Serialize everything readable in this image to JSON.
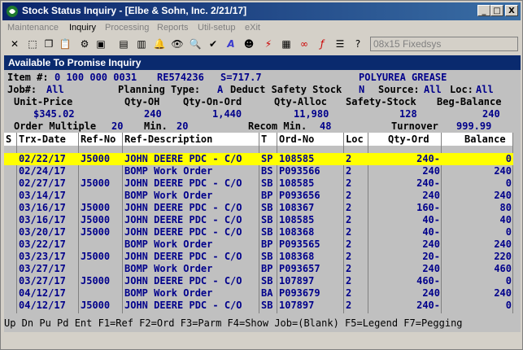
{
  "window": {
    "title": "Stock Status Inquiry - [Elbe & Sohn, Inc. 2/21/17]",
    "buttons": {
      "minimize": "_",
      "maximize": "□",
      "close": "X"
    }
  },
  "menu": {
    "items": [
      {
        "label": "Maintenance",
        "enabled": false
      },
      {
        "label": "Inquiry",
        "enabled": true
      },
      {
        "label": "Processing",
        "enabled": false
      },
      {
        "label": "Reports",
        "enabled": false
      },
      {
        "label": "Util-setup",
        "enabled": false
      },
      {
        "label": "eXit",
        "enabled": false
      }
    ]
  },
  "toolbar": {
    "font_select": "08x15 Fixedsys"
  },
  "screen": {
    "header": "Available To Promise Inquiry",
    "item_line": {
      "item_label": "Item #:",
      "item_number": "0 100 000 0031",
      "ref_no": "RE574236",
      "s_value": "S=717.7",
      "description": "POLYUREA GREASE"
    },
    "job_line": {
      "job_label": "Job#:",
      "job_value": "All",
      "planning_label": "Planning Type:",
      "planning_value": "A",
      "deduct_label": "Deduct Safety Stock",
      "deduct_value": "N",
      "source_label": "Source:",
      "source_value": "All",
      "loc_label": "Loc:",
      "loc_value": "All"
    },
    "stats_headers": {
      "unit_price": "Unit-Price",
      "qty_oh": "Qty-OH",
      "qty_on_ord": "Qty-On-Ord",
      "qty_alloc": "Qty-Alloc",
      "safety_stock": "Safety-Stock",
      "beg_balance": "Beg-Balance"
    },
    "stats_values": {
      "unit_price": "$345.02",
      "qty_oh": "240",
      "qty_on_ord": "1,440",
      "qty_alloc": "11,980",
      "safety_stock": "128",
      "beg_balance": "240"
    },
    "order_line": {
      "order_multiple_label": "Order Multiple",
      "order_multiple_value": "20",
      "min_label": "Min.",
      "min_value": "20",
      "recom_min_label": "Recom Min.",
      "recom_min_value": "48",
      "turnover_label": "Turnover",
      "turnover_value": "999.99"
    }
  },
  "table": {
    "columns": [
      "S",
      "Trx-Date",
      "Ref-No",
      "Ref-Description",
      "T",
      "Ord-No",
      "Loc",
      "Qty-Ord",
      "Balance"
    ],
    "rows": [
      {
        "s": "",
        "date": "02/22/17",
        "ref_no": "J5000",
        "desc": "JOHN DEERE PDC - C/O",
        "t": "SP",
        "ord_no": "108585",
        "loc": "2",
        "qty": "240-",
        "bal": "0",
        "selected": true
      },
      {
        "s": "",
        "date": "02/24/17",
        "ref_no": "",
        "desc": "BOMP Work Order",
        "t": "BS",
        "ord_no": "P093566",
        "loc": "2",
        "qty": "240",
        "bal": "240"
      },
      {
        "s": "",
        "date": "02/27/17",
        "ref_no": "J5000",
        "desc": "JOHN DEERE PDC - C/O",
        "t": "SB",
        "ord_no": "108585",
        "loc": "2",
        "qty": "240-",
        "bal": "0"
      },
      {
        "s": "",
        "date": "03/14/17",
        "ref_no": "",
        "desc": "BOMP Work Order",
        "t": "BP",
        "ord_no": "P093656",
        "loc": "2",
        "qty": "240",
        "bal": "240"
      },
      {
        "s": "",
        "date": "03/16/17",
        "ref_no": "J5000",
        "desc": "JOHN DEERE PDC - C/O",
        "t": "SB",
        "ord_no": "108367",
        "loc": "2",
        "qty": "160-",
        "bal": "80"
      },
      {
        "s": "",
        "date": "03/16/17",
        "ref_no": "J5000",
        "desc": "JOHN DEERE PDC - C/O",
        "t": "SB",
        "ord_no": "108585",
        "loc": "2",
        "qty": "40-",
        "bal": "40"
      },
      {
        "s": "",
        "date": "03/20/17",
        "ref_no": "J5000",
        "desc": "JOHN DEERE PDC - C/O",
        "t": "SB",
        "ord_no": "108368",
        "loc": "2",
        "qty": "40-",
        "bal": "0"
      },
      {
        "s": "",
        "date": "03/22/17",
        "ref_no": "",
        "desc": "BOMP Work Order",
        "t": "BP",
        "ord_no": "P093565",
        "loc": "2",
        "qty": "240",
        "bal": "240"
      },
      {
        "s": "",
        "date": "03/23/17",
        "ref_no": "J5000",
        "desc": "JOHN DEERE PDC - C/O",
        "t": "SB",
        "ord_no": "108368",
        "loc": "2",
        "qty": "20-",
        "bal": "220"
      },
      {
        "s": "",
        "date": "03/27/17",
        "ref_no": "",
        "desc": "BOMP Work Order",
        "t": "BP",
        "ord_no": "P093657",
        "loc": "2",
        "qty": "240",
        "bal": "460"
      },
      {
        "s": "",
        "date": "03/27/17",
        "ref_no": "J5000",
        "desc": "JOHN DEERE PDC - C/O",
        "t": "SB",
        "ord_no": "107897",
        "loc": "2",
        "qty": "460-",
        "bal": "0"
      },
      {
        "s": "",
        "date": "04/12/17",
        "ref_no": "",
        "desc": "BOMP Work Order",
        "t": "BA",
        "ord_no": "P093679",
        "loc": "2",
        "qty": "240",
        "bal": "240"
      },
      {
        "s": "",
        "date": "04/12/17",
        "ref_no": "J5000",
        "desc": "JOHN DEERE PDC - C/O",
        "t": "SB",
        "ord_no": "107897",
        "loc": "2",
        "qty": "240-",
        "bal": "0"
      }
    ]
  },
  "footer": "Up Dn Pu Pd Ent F1=Ref F2=Ord F3=Parm F4=Show Job=(Blank) F5=Legend F7=Pegging"
}
